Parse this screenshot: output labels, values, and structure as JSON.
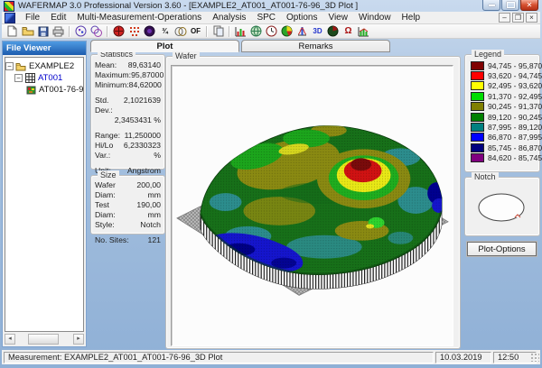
{
  "window": {
    "title": "WAFERMAP 3.0  Professional Version 3.60 - [EXAMPLE2_AT001_AT001-76-96_3D Plot ]"
  },
  "menu": {
    "items": [
      "File",
      "Edit",
      "Multi-Measurement-Operations",
      "Analysis",
      "SPC",
      "Options",
      "View",
      "Window",
      "Help"
    ]
  },
  "toolbar": {
    "icons": [
      "new-document",
      "open-folder",
      "save",
      "print",
      "wafer-map-purple",
      "wafer-stack-purple",
      "contour-map-red",
      "site-map-red",
      "disk-map-dark",
      "fraction-three-quarter",
      "overlay-maps",
      "of-map",
      "copy",
      "histogram",
      "globe-chart",
      "clock-chart",
      "pie-chart",
      "distribution-chart",
      "3d-plot",
      "sphere-chart",
      "omega-stats",
      "trend-chart"
    ],
    "of_label": "OF",
    "fraction_label": "¾",
    "threed_label": "3D",
    "omega_label": "Ω"
  },
  "file_viewer": {
    "title": "File Viewer",
    "tree": [
      {
        "label": "EXAMPLE2"
      },
      {
        "label": "AT001"
      },
      {
        "label": "AT001-76-9"
      }
    ]
  },
  "statistics": {
    "title": "Statistics",
    "mean_label": "Mean:",
    "mean": "89,63140",
    "max_label": "Maximum:",
    "max": "95,87000",
    "min_label": "Minimum:",
    "min": "84,62000",
    "stddev_label": "Std. Dev.:",
    "stddev": "2,1021639",
    "stddev_pct": "2,3453431 %",
    "range_label": "Range:",
    "range": "11,250000",
    "hilo_label": "Hi/Lo Var.:",
    "hilo": "6,2330323 %",
    "unit_label": "Unit:",
    "unit": "Angstrom"
  },
  "size": {
    "title": "Size",
    "wafer_diam_label": "Wafer Diam:",
    "wafer_diam": "200,00 mm",
    "test_diam_label": "Test Diam:",
    "test_diam": "190,00 mm",
    "style_label": "Style:",
    "style": "Notch",
    "sites_label": "No. Sites:",
    "sites": "121"
  },
  "tabs": {
    "plot": "Plot",
    "remarks": "Remarks"
  },
  "wafer_box": {
    "title": "Wafer"
  },
  "legend": {
    "title": "Legend",
    "entries": [
      {
        "color": "#7f0000",
        "range": "94,745 - 95,870"
      },
      {
        "color": "#ff0000",
        "range": "93,620 - 94,745"
      },
      {
        "color": "#ffff00",
        "range": "92,495 - 93,620"
      },
      {
        "color": "#00dd00",
        "range": "91,370 - 92,495"
      },
      {
        "color": "#808000",
        "range": "90,245 - 91,370"
      },
      {
        "color": "#008000",
        "range": "89,120 - 90,245"
      },
      {
        "color": "#008080",
        "range": "87,995 - 89,120"
      },
      {
        "color": "#0000ff",
        "range": "86,870 - 87,995"
      },
      {
        "color": "#000080",
        "range": "85,745 - 86,870"
      },
      {
        "color": "#800080",
        "range": "84,620 - 85,745"
      }
    ]
  },
  "notch": {
    "title": "Notch"
  },
  "buttons": {
    "plot_options": "Plot-Options"
  },
  "status": {
    "measurement": "Measurement: EXAMPLE2_AT001_AT001-76-96_3D Plot",
    "date": "10.03.2019",
    "time": "12:50"
  }
}
